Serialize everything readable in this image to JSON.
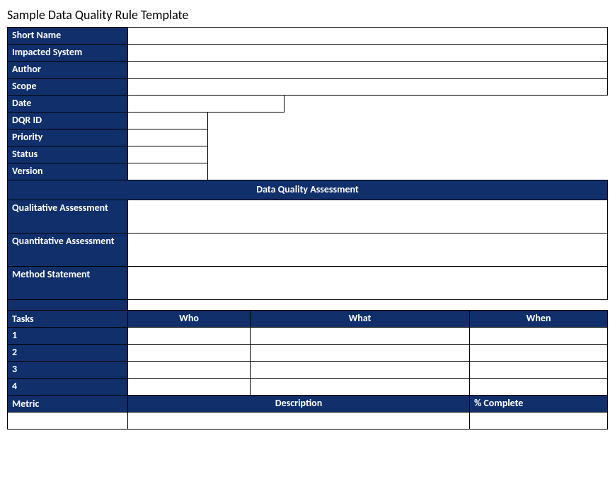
{
  "title": "Sample Data Quality Rule Template",
  "fields": {
    "shortName": {
      "label": "Short Name",
      "value": ""
    },
    "impactedSystem": {
      "label": "Impacted System",
      "value": ""
    },
    "author": {
      "label": "Author",
      "value": ""
    },
    "scope": {
      "label": "Scope",
      "value": ""
    },
    "date": {
      "label": "Date",
      "value": ""
    },
    "dqrId": {
      "label": "DQR ID",
      "value": ""
    },
    "priority": {
      "label": "Priority",
      "value": ""
    },
    "status": {
      "label": "Status",
      "value": ""
    },
    "version": {
      "label": "Version",
      "value": ""
    }
  },
  "assessmentHeader": "Data Quality Assessment",
  "assessments": {
    "qualitative": {
      "label": "Qualitative Assessment",
      "value": ""
    },
    "quantitative": {
      "label": "Quantitative Assessment",
      "value": ""
    },
    "methodStatement": {
      "label": "Method Statement",
      "value": ""
    }
  },
  "tasksSection": {
    "label": "Tasks",
    "columns": {
      "who": "Who",
      "what": "What",
      "when": "When"
    },
    "rows": [
      {
        "num": "1",
        "who": "",
        "what": "",
        "when": ""
      },
      {
        "num": "2",
        "who": "",
        "what": "",
        "when": ""
      },
      {
        "num": "3",
        "who": "",
        "what": "",
        "when": ""
      },
      {
        "num": "4",
        "who": "",
        "what": "",
        "when": ""
      }
    ]
  },
  "metricSection": {
    "label": "Metric",
    "columns": {
      "description": "Description",
      "pctComplete": "% Complete"
    },
    "row": {
      "name": "",
      "description": "",
      "pctComplete": ""
    }
  }
}
